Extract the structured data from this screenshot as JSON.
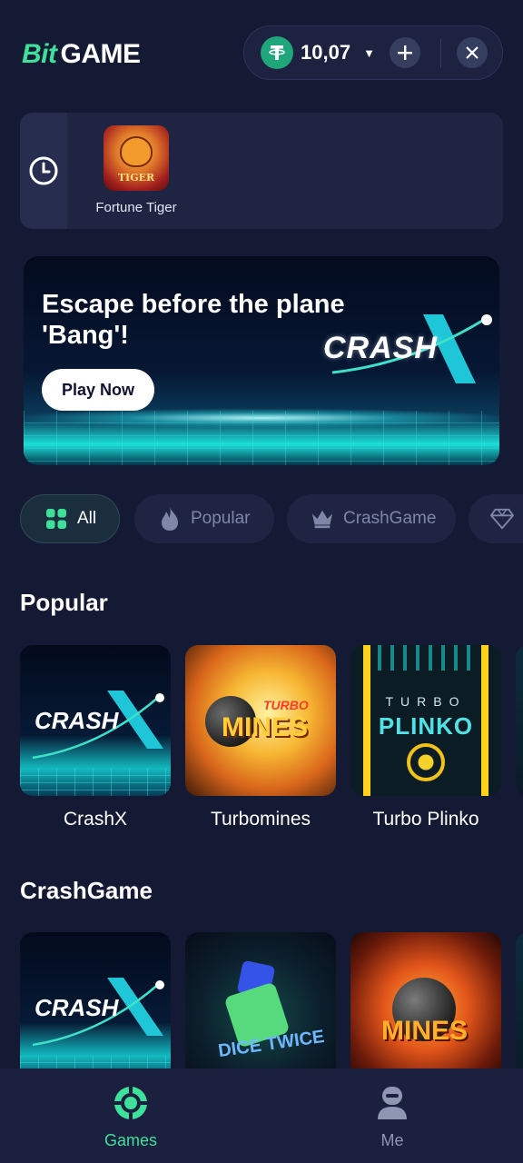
{
  "header": {
    "logo_bit": "Bit",
    "logo_game": "GAME",
    "balance": "10,07",
    "currency_icon": "tether-icon"
  },
  "recent": {
    "games": [
      {
        "name": "Fortune Tiger",
        "thumb_text": "TIGER"
      }
    ]
  },
  "banner": {
    "title": "Escape before the plane 'Bang'!",
    "cta": "Play Now",
    "logo_text": "CRASH"
  },
  "filters": [
    {
      "label": "All",
      "active": true,
      "icon": "grid-icon"
    },
    {
      "label": "Popular",
      "active": false,
      "icon": "fire-icon"
    },
    {
      "label": "CrashGame",
      "active": false,
      "icon": "crown-icon"
    },
    {
      "label": "",
      "active": false,
      "icon": "diamond-icon"
    }
  ],
  "sections": [
    {
      "title": "Popular",
      "games": [
        {
          "name": "CrashX",
          "thumb_text": "CRASH"
        },
        {
          "name": "Turbomines",
          "thumb_text": "MINES",
          "thumb_sub": "TURBO"
        },
        {
          "name": "Turbo Plinko",
          "thumb_text": "PLINKO",
          "thumb_sub": "TURBO"
        }
      ]
    },
    {
      "title": "CrashGame",
      "games": [
        {
          "name": "",
          "thumb_text": "CRASH"
        },
        {
          "name": "",
          "thumb_text": "DICE TWICE"
        },
        {
          "name": "",
          "thumb_text": "MINES"
        }
      ]
    }
  ],
  "bottom_nav": [
    {
      "label": "Games",
      "active": true,
      "icon": "games-icon"
    },
    {
      "label": "Me",
      "active": false,
      "icon": "profile-icon"
    }
  ],
  "colors": {
    "background": "#141a33",
    "accent_green": "#3ee09a",
    "tether_green": "#1fa67a",
    "panel": "#1e2442"
  }
}
